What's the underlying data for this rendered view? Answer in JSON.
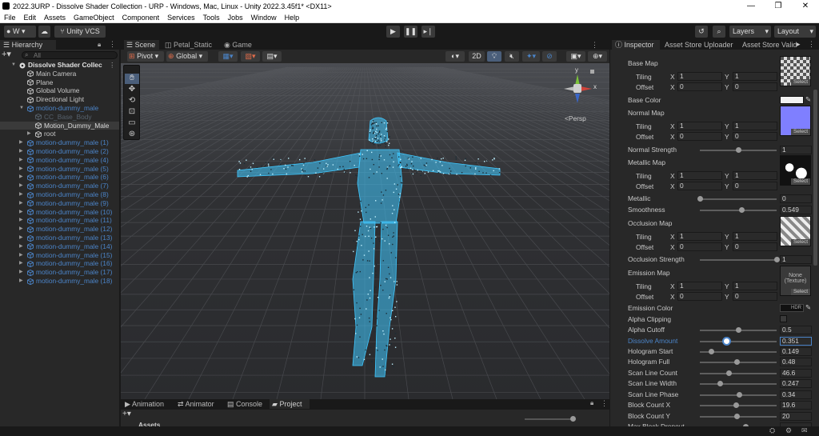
{
  "titlebar": {
    "title": "2022.3URP - Dissolve Shader Collection - URP - Windows, Mac, Linux - Unity 2022.3.45f1* <DX11>",
    "minimize": "—",
    "maximize": "❐",
    "close": "✕"
  },
  "menu": [
    "File",
    "Edit",
    "Assets",
    "GameObject",
    "Component",
    "Services",
    "Tools",
    "Jobs",
    "Window",
    "Help"
  ],
  "toolbar": {
    "account_label": "W",
    "vcs_label": "Unity VCS",
    "layers_label": "Layers",
    "layout_label": "Layout"
  },
  "hierarchy": {
    "tab": "Hierarchy",
    "search_placeholder": "All",
    "rows": [
      {
        "label": "Dissolve Shader Collec",
        "style": "scene",
        "indent": 0,
        "arrow": "▼"
      },
      {
        "label": "Main Camera",
        "style": "normal",
        "indent": 1,
        "arrow": ""
      },
      {
        "label": "Plane",
        "style": "normal",
        "indent": 1,
        "arrow": ""
      },
      {
        "label": "Global Volume",
        "style": "normal",
        "indent": 1,
        "arrow": ""
      },
      {
        "label": "Directional Light",
        "style": "normal",
        "indent": 1,
        "arrow": ""
      },
      {
        "label": "motion-dummy_male",
        "style": "blue",
        "indent": 1,
        "arrow": "▼"
      },
      {
        "label": "CC_Base_Body",
        "style": "dim",
        "indent": 2,
        "arrow": ""
      },
      {
        "label": "Motion_Dummy_Male",
        "style": "selected",
        "indent": 2,
        "arrow": ""
      },
      {
        "label": "root",
        "style": "normal",
        "indent": 2,
        "arrow": "▶"
      },
      {
        "label": "motion-dummy_male (1)",
        "style": "blue",
        "indent": 1,
        "arrow": "▶"
      },
      {
        "label": "motion-dummy_male (2)",
        "style": "blue",
        "indent": 1,
        "arrow": "▶"
      },
      {
        "label": "motion-dummy_male (4)",
        "style": "blue",
        "indent": 1,
        "arrow": "▶"
      },
      {
        "label": "motion-dummy_male (5)",
        "style": "blue",
        "indent": 1,
        "arrow": "▶"
      },
      {
        "label": "motion-dummy_male (6)",
        "style": "blue",
        "indent": 1,
        "arrow": "▶"
      },
      {
        "label": "motion-dummy_male (7)",
        "style": "blue",
        "indent": 1,
        "arrow": "▶"
      },
      {
        "label": "motion-dummy_male (8)",
        "style": "blue",
        "indent": 1,
        "arrow": "▶"
      },
      {
        "label": "motion-dummy_male (9)",
        "style": "blue",
        "indent": 1,
        "arrow": "▶"
      },
      {
        "label": "motion-dummy_male (10)",
        "style": "blue",
        "indent": 1,
        "arrow": "▶"
      },
      {
        "label": "motion-dummy_male (11)",
        "style": "blue",
        "indent": 1,
        "arrow": "▶"
      },
      {
        "label": "motion-dummy_male (12)",
        "style": "blue",
        "indent": 1,
        "arrow": "▶"
      },
      {
        "label": "motion-dummy_male (13)",
        "style": "blue",
        "indent": 1,
        "arrow": "▶"
      },
      {
        "label": "motion-dummy_male (14)",
        "style": "blue",
        "indent": 1,
        "arrow": "▶"
      },
      {
        "label": "motion-dummy_male (15)",
        "style": "blue",
        "indent": 1,
        "arrow": "▶"
      },
      {
        "label": "motion-dummy_male (16)",
        "style": "blue",
        "indent": 1,
        "arrow": "▶"
      },
      {
        "label": "motion-dummy_male (17)",
        "style": "blue",
        "indent": 1,
        "arrow": "▶"
      },
      {
        "label": "motion-dummy_male (18)",
        "style": "blue",
        "indent": 1,
        "arrow": "▶"
      }
    ]
  },
  "scene": {
    "tabs": [
      "Scene",
      "Petal_Static",
      "Game"
    ],
    "pivot_label": "Pivot",
    "global_label": "Global",
    "mode_2d": "2D",
    "persp_label": "<Persp",
    "gizmo_y": "y",
    "gizmo_x": "x"
  },
  "bottom": {
    "tabs": [
      "Animation",
      "Animator",
      "Console",
      "Project"
    ],
    "assets_label": "Assets"
  },
  "inspector": {
    "tabs": [
      "Inspector",
      "Asset Store Uploader",
      "Asset Store Valid"
    ],
    "tiling_label": "Tiling",
    "offset_label": "Offset",
    "x_label": "X",
    "y_label": "Y",
    "select_label": "Select",
    "none_texture_label": "None (Texture)",
    "hdr_label": "HDR",
    "maps": [
      {
        "name": "Base Map",
        "tiling_x": "1",
        "tiling_y": "1",
        "offset_x": "0",
        "offset_y": "0"
      },
      {
        "name": "Normal Map",
        "tiling_x": "1",
        "tiling_y": "1",
        "offset_x": "0",
        "offset_y": "0"
      },
      {
        "name": "Metallic Map",
        "tiling_x": "1",
        "tiling_y": "1",
        "offset_x": "0",
        "offset_y": "0"
      },
      {
        "name": "Occlusion Map",
        "tiling_x": "1",
        "tiling_y": "1",
        "offset_x": "0",
        "offset_y": "0"
      },
      {
        "name": "Emission Map",
        "tiling_x": "1",
        "tiling_y": "1",
        "offset_x": "0",
        "offset_y": "0"
      }
    ],
    "base_color_label": "Base Color",
    "base_color": "#f2f2f2",
    "emission_color_label": "Emission Color",
    "alpha_clipping_label": "Alpha Clipping",
    "sliders": {
      "normal_strength": {
        "label": "Normal Strength",
        "value": "1",
        "fraction": 0.5
      },
      "metallic": {
        "label": "Metallic",
        "value": "0",
        "fraction": 0.0
      },
      "smoothness": {
        "label": "Smoothness",
        "value": "0.549",
        "fraction": 0.549
      },
      "occlusion_strength": {
        "label": "Occlusion Strength",
        "value": "1",
        "fraction": 1.0
      },
      "alpha_cutoff": {
        "label": "Alpha Cutoff",
        "value": "0.5",
        "fraction": 0.5
      },
      "dissolve_amount": {
        "label": "Dissolve Amount",
        "value": "0.351",
        "fraction": 0.351
      },
      "hologram_start": {
        "label": "Hologram Start",
        "value": "0.149",
        "fraction": 0.149
      },
      "hologram_full": {
        "label": "Hologram Full",
        "value": "0.48",
        "fraction": 0.48
      },
      "scan_line_count": {
        "label": "Scan Line Count",
        "value": "46.6",
        "fraction": 0.38
      },
      "scan_line_width": {
        "label": "Scan Line Width",
        "value": "0.247",
        "fraction": 0.27
      },
      "scan_line_phase": {
        "label": "Scan Line Phase",
        "value": "0.34",
        "fraction": 0.52
      },
      "block_count_x": {
        "label": "Block Count X",
        "value": "19.6",
        "fraction": 0.47
      },
      "block_count_y": {
        "label": "Block Count Y",
        "value": "20",
        "fraction": 0.48
      },
      "max_block_dropout": {
        "label": "Max Block Dropout",
        "value": "",
        "fraction": 0.6
      }
    }
  },
  "colors": {
    "accent_blue": "#4b84c8",
    "dissolve_cyan": "#3fc8ff",
    "selected_row": "#3a3a3a"
  }
}
